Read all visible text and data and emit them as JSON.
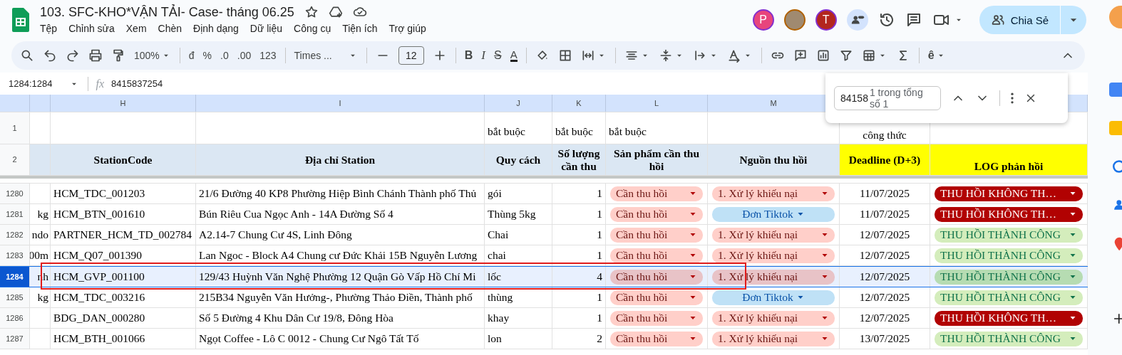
{
  "document": {
    "title": "103. SFC-KHO*VẬN TẢI- Case- tháng 06.25"
  },
  "menu": [
    {
      "label": "Tệp"
    },
    {
      "label": "Chỉnh sửa"
    },
    {
      "label": "Xem"
    },
    {
      "label": "Chèn"
    },
    {
      "label": "Định dạng"
    },
    {
      "label": "Dữ liệu"
    },
    {
      "label": "Công cụ"
    },
    {
      "label": "Tiện ích"
    },
    {
      "label": "Trợ giúp"
    }
  ],
  "collaborators": [
    {
      "kind": "letter",
      "initial": "P",
      "color": "#e8457c"
    },
    {
      "kind": "photo"
    },
    {
      "kind": "letter",
      "initial": "T",
      "color": "#b3261e"
    },
    {
      "kind": "group"
    }
  ],
  "share_button": {
    "label": "Chia Sẻ"
  },
  "toolbar": {
    "zoom": "100%",
    "currency": "đ",
    "percent": "%",
    "decrease_decimal": ".0",
    "increase_decimal": ".00",
    "number_format": "123",
    "font": "Times ...",
    "font_size": "12",
    "bold": "B",
    "italic": "I",
    "strikethrough": "S",
    "text_color": "A",
    "input_tools": "ê"
  },
  "formula_bar": {
    "name_box": "1284:1284",
    "fx": "fx",
    "value": "8415837254"
  },
  "find_bar": {
    "query": "84158",
    "result": "1 trong tổng số 1"
  },
  "sheet": {
    "column_letters": [
      "H",
      "I",
      "J",
      "K",
      "L",
      "M"
    ],
    "note_row": {
      "number": "1",
      "column_j": "bắt buộc",
      "column_k": "bắt buộc",
      "column_l": "bắt buộc",
      "column_n": "công thức"
    },
    "header_row": {
      "number": "2",
      "cells": [
        {
          "text": "StationCode",
          "highlighted": false
        },
        {
          "text": "Địa chỉ Station",
          "highlighted": false
        },
        {
          "text": "Quy cách",
          "highlighted": false
        },
        {
          "text": "Số lượng cần thu",
          "highlighted": false
        },
        {
          "text": "Sản phẩm cần thu hồi",
          "highlighted": false
        },
        {
          "text": "Nguồn thu hồi",
          "highlighted": false
        },
        {
          "text": "Deadline (D+3)",
          "highlighted": true
        },
        {
          "text": "LOG phản hồi",
          "highlighted": true
        }
      ]
    },
    "rows": [
      {
        "number": "1280",
        "selected": false,
        "station_code": "HCM_TDC_001203",
        "address": "21/6 Đường 40 KP8 Phường Hiệp Bình Chánh Thành phố Thủ",
        "spec": "gói",
        "quantity": "1",
        "product": {
          "text": "Cần thu hồi",
          "kind": "claim"
        },
        "source": {
          "text": "1. Xử lý khiếu nại",
          "kind": "claim"
        },
        "deadline": "11/07/2025",
        "log": {
          "text": "THU HỒI KHÔNG TH…",
          "kind": "failed"
        }
      },
      {
        "number": "1281",
        "selected": false,
        "column_g": "kg",
        "station_code": "HCM_BTN_001610",
        "address": "Bún Riêu Cua Ngọc Anh - 14A Đường Số 4",
        "spec": "Thùng 5kg",
        "quantity": "1",
        "product": {
          "text": "Cần thu hồi",
          "kind": "claim"
        },
        "source": {
          "text": "Đơn Tiktok",
          "kind": "tiktok"
        },
        "deadline": "11/07/2025",
        "log": {
          "text": "THU HỒI KHÔNG TH…",
          "kind": "failed"
        }
      },
      {
        "number": "1282",
        "selected": false,
        "column_g": "ndo",
        "station_code": "PARTNER_HCM_TD_002784",
        "address": "A2.14-7 Chung Cư 4S, Linh Đông",
        "spec": "Chai",
        "quantity": "1",
        "product": {
          "text": "Cần thu hồi",
          "kind": "claim"
        },
        "source": {
          "text": "1. Xử lý khiếu nại",
          "kind": "claim"
        },
        "deadline": "12/07/2025",
        "log": {
          "text": "THU HỒI THÀNH CÔNG",
          "kind": "success"
        }
      },
      {
        "number": "1283",
        "selected": false,
        "column_g": "00m",
        "station_code": "HCM_Q07_001390",
        "address": "Lan Ngoc - Block A4 Chung cư Đức Khải 15B Nguyễn Lương",
        "spec": "chai",
        "quantity": "1",
        "product": {
          "text": "Cần thu hồi",
          "kind": "claim"
        },
        "source": {
          "text": "1. Xử lý khiếu nại",
          "kind": "claim"
        },
        "deadline": "12/07/2025",
        "log": {
          "text": "THU HỒI THÀNH CÔNG",
          "kind": "success"
        }
      },
      {
        "number": "1284",
        "selected": true,
        "column_g": "nh",
        "station_code": "HCM_GVP_001100",
        "address": "129/43 Huỳnh Văn Nghệ Phường 12 Quận Gò Vấp Hồ Chí Mi",
        "spec": "lốc",
        "quantity": "4",
        "product": {
          "text": "Cần thu hồi",
          "kind": "claim"
        },
        "source": {
          "text": "1. Xử lý khiếu nại",
          "kind": "claim"
        },
        "deadline": "12/07/2025",
        "log": {
          "text": "THU HỒI THÀNH CÔNG",
          "kind": "success"
        }
      },
      {
        "number": "1285",
        "selected": false,
        "column_g": "kg",
        "station_code": "HCM_TDC_003216",
        "address": "215B34 Nguyễn Văn Hưởng-, Phường Thảo Điền, Thành phố",
        "spec": "thùng",
        "quantity": "1",
        "product": {
          "text": "Cần thu hồi",
          "kind": "claim"
        },
        "source": {
          "text": "Đơn Tiktok",
          "kind": "tiktok"
        },
        "deadline": "12/07/2025",
        "log": {
          "text": "THU HỒI THÀNH CÔNG",
          "kind": "success"
        }
      },
      {
        "number": "1286",
        "selected": false,
        "station_code": "BDG_DAN_000280",
        "address": "Số 5 Đường 4 Khu Dân Cư 19/8, Đông Hòa",
        "spec": "khay",
        "quantity": "1",
        "product": {
          "text": "Cần thu hồi",
          "kind": "claim"
        },
        "source": {
          "text": "1. Xử lý khiếu nại",
          "kind": "claim"
        },
        "deadline": "12/07/2025",
        "log": {
          "text": "THU HỒI KHÔNG TH…",
          "kind": "failed"
        }
      },
      {
        "number": "1287",
        "selected": false,
        "station_code": "HCM_BTH_001066",
        "address": "Ngọt Coffee - Lô C 0012 - Chung Cư Ngô Tất Tố",
        "spec": "lon",
        "quantity": "2",
        "product": {
          "text": "Cần thu hồi",
          "kind": "claim"
        },
        "source": {
          "text": "1. Xử lý khiếu nại",
          "kind": "claim"
        },
        "deadline": "13/07/2025",
        "log": {
          "text": "THU HỒI THÀNH CÔNG",
          "kind": "success"
        }
      }
    ]
  }
}
